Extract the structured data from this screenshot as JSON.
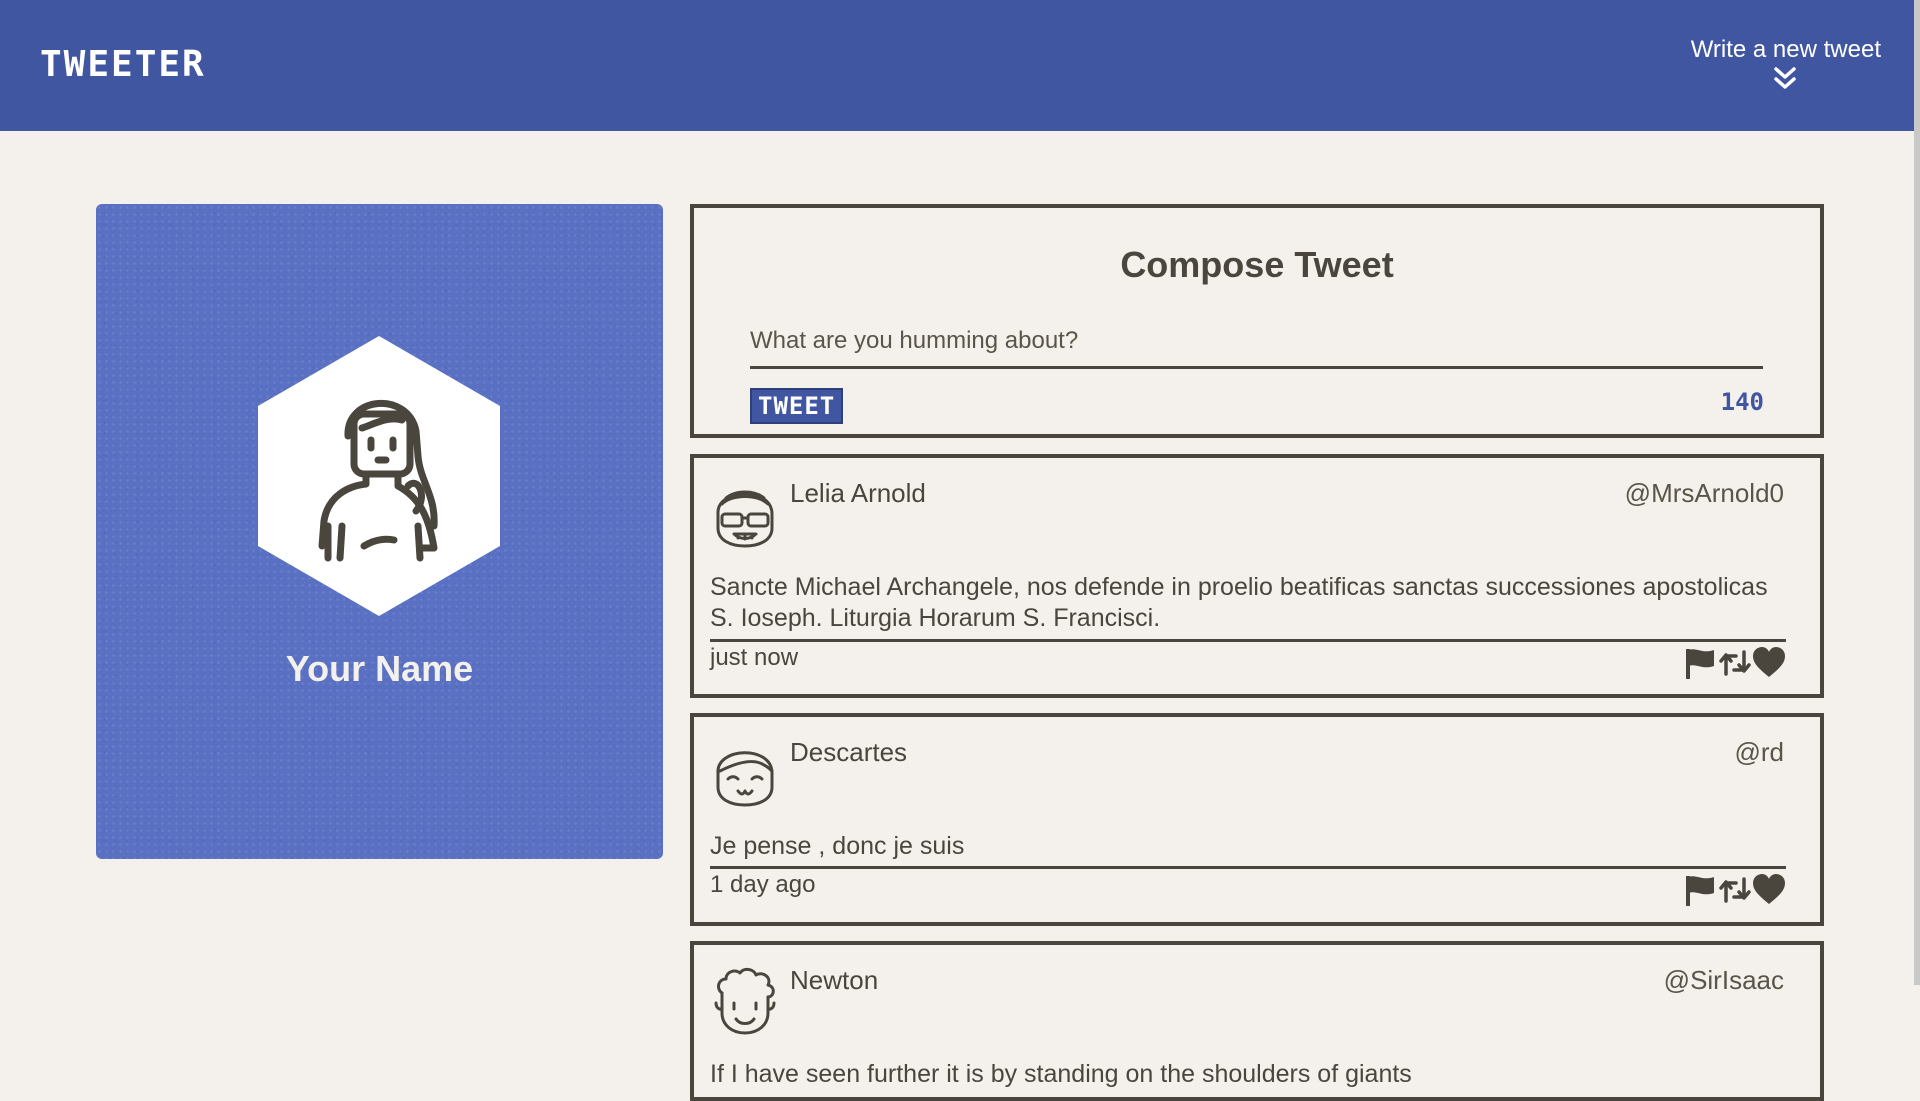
{
  "nav": {
    "brand": "TWEETER",
    "write_label": "Write a new tweet",
    "write_icon": "double-chevron-down-icon"
  },
  "profile": {
    "name": "Your Name",
    "avatar_icon": "woman-avatar-icon"
  },
  "compose": {
    "title": "Compose Tweet",
    "placeholder": "What are you humming about?",
    "value": "",
    "button_label": "TWEET",
    "counter": "140"
  },
  "tweets": [
    {
      "name": "Lelia Arnold",
      "handle": "@MrsArnold0",
      "content": "Sancte Michael Archangele, nos defende in proelio beatificas sanctas successiones apostolicas S. Ioseph. Liturgia Horarum S. Francisci.",
      "time": "just now",
      "avatar_icon": "glasses-girl-avatar-icon"
    },
    {
      "name": "Descartes",
      "handle": "@rd",
      "content": "Je pense , donc je suis",
      "time": "1 day ago",
      "avatar_icon": "smiling-girl-avatar-icon"
    },
    {
      "name": "Newton",
      "handle": "@SirIsaac",
      "content": "If I have seen further it is by standing on the shoulders of giants",
      "time": "",
      "avatar_icon": "curly-hair-avatar-icon"
    }
  ],
  "actions": {
    "flag_icon": "flag-icon",
    "retweet_icon": "retweet-icon",
    "like_icon": "heart-icon"
  },
  "colors": {
    "primary": "#4056a1",
    "profile_bg": "#5a70c3",
    "page_bg": "#f4f1ec",
    "text": "#4a463e"
  }
}
